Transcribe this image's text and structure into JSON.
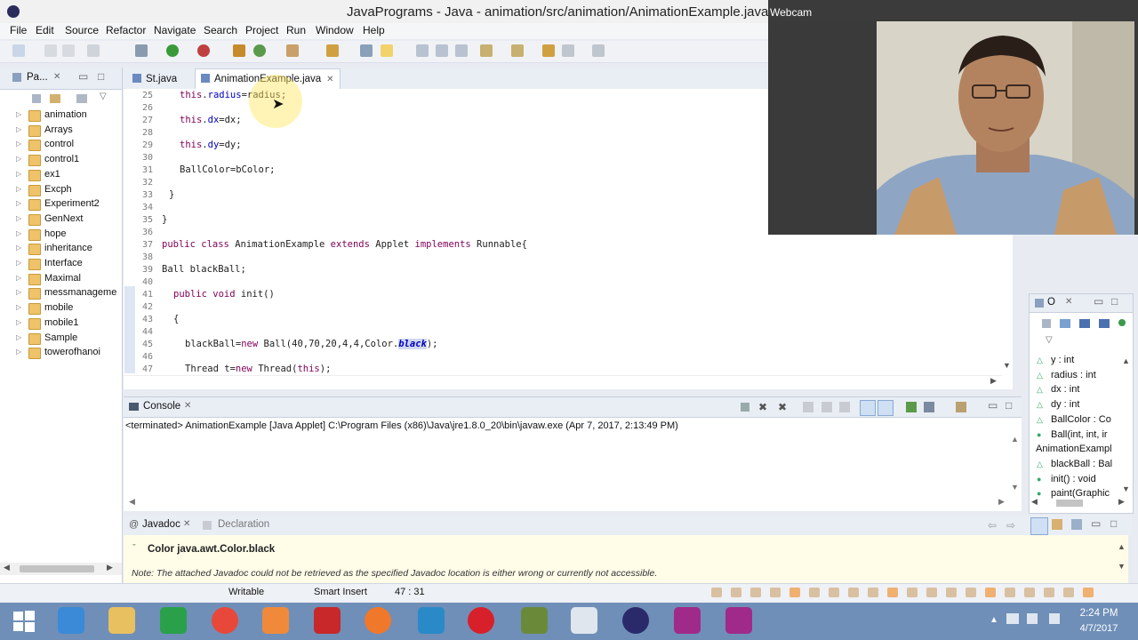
{
  "window": {
    "title": "JavaPrograms - Java - animation/src/animation/AnimationExample.java - Ecl",
    "webcam_label": "Webcam"
  },
  "menu": [
    "File",
    "Edit",
    "Source",
    "Refactor",
    "Navigate",
    "Search",
    "Project",
    "Run",
    "Window",
    "Help"
  ],
  "explorer": {
    "tab_label": "Pa...",
    "projects": [
      "animation",
      "Arrays",
      "control",
      "control1",
      "ex1",
      "Excph",
      "Experiment2",
      "GenNext",
      "hope",
      "inheritance",
      "Interface",
      "Maximal",
      "messmanageme",
      "mobile",
      "mobile1",
      "Sample",
      "towerofhanoi"
    ]
  },
  "editor": {
    "tabs": [
      "St.java",
      "AnimationExample.java"
    ],
    "active_tab": "AnimationExample.java",
    "lines": [
      {
        "n": "25",
        "text": "this.radius=radius;"
      },
      {
        "n": "26",
        "text": ""
      },
      {
        "n": "27",
        "text": "this.dx=dx;"
      },
      {
        "n": "28",
        "text": ""
      },
      {
        "n": "29",
        "text": "this.dy=dy;"
      },
      {
        "n": "30",
        "text": ""
      },
      {
        "n": "31",
        "text": "BallColor=bColor;"
      },
      {
        "n": "32",
        "text": ""
      },
      {
        "n": "33",
        "text": "}"
      },
      {
        "n": "34",
        "text": ""
      },
      {
        "n": "35",
        "text": "}"
      },
      {
        "n": "36",
        "text": ""
      },
      {
        "n": "37",
        "text": "public class AnimationExample extends Applet implements Runnable{"
      },
      {
        "n": "38",
        "text": ""
      },
      {
        "n": "39",
        "text": "Ball blackBall;"
      },
      {
        "n": "40",
        "text": ""
      },
      {
        "n": "41",
        "text": "public void init()"
      },
      {
        "n": "42",
        "text": ""
      },
      {
        "n": "43",
        "text": "{"
      },
      {
        "n": "44",
        "text": ""
      },
      {
        "n": "45",
        "text": "blackBall=new Ball(40,70,20,4,4,Color.black);"
      },
      {
        "n": "46",
        "text": ""
      },
      {
        "n": "47",
        "text": "Thread t=new Thread(this);"
      }
    ]
  },
  "console": {
    "tab_label": "Console",
    "output": "<terminated> AnimationExample [Java Applet] C:\\Program Files (x86)\\Java\\jre1.8.0_20\\bin\\javaw.exe (Apr 7, 2017, 2:13:49 PM)"
  },
  "javadoc": {
    "tab_label": "Javadoc",
    "tab2_label": "Declaration",
    "heading": "Color java.awt.Color.black",
    "note": "Note: The attached Javadoc could not be retrieved as the specified Javadoc location is either wrong or currently not accessible."
  },
  "outline": {
    "tab_label": "O",
    "items": [
      "y : int",
      "radius : int",
      "dx : int",
      "dy : int",
      "BallColor : Co",
      "Ball(int, int, ir",
      "AnimationExampl",
      "blackBall : Bal",
      "init() : void",
      "paint(Graphic"
    ]
  },
  "status": {
    "writable": "Writable",
    "insert_mode": "Smart Insert",
    "position": "47 : 31"
  },
  "taskbar": {
    "time": "2:24 PM",
    "date": "4/7/2017"
  },
  "colors": {
    "accent": "#4a6fa5",
    "keyword": "#7f0055",
    "field": "#0000c0"
  }
}
